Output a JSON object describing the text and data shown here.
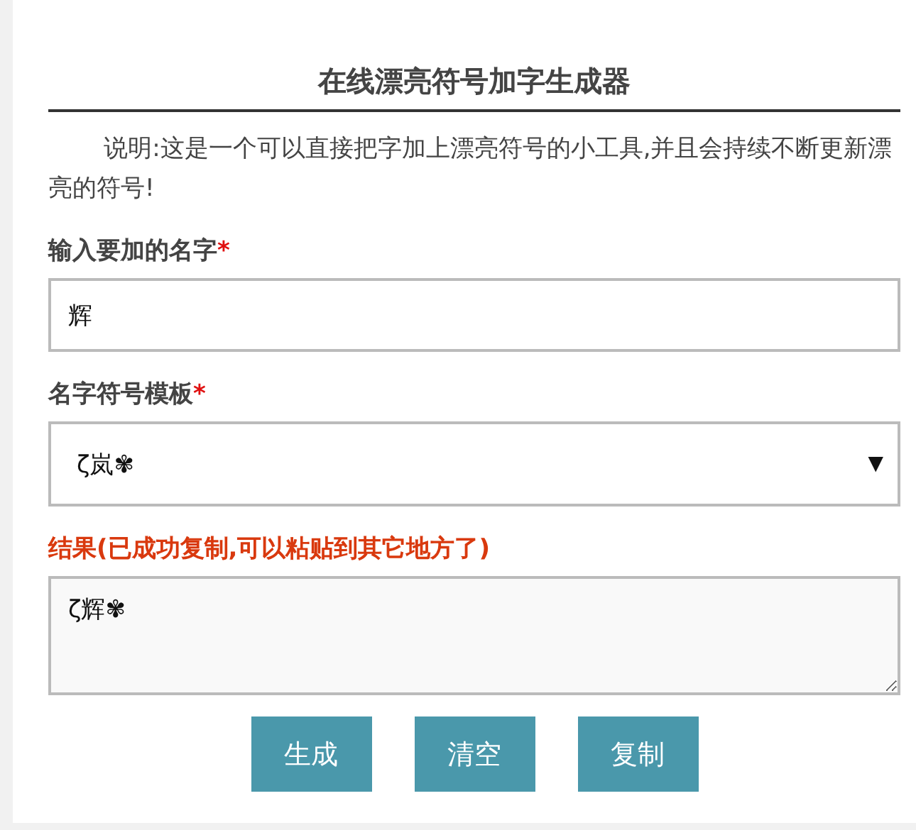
{
  "title": "在线漂亮符号加字生成器",
  "description": "说明:这是一个可以直接把字加上漂亮符号的小工具,并且会持续不断更新漂亮的符号!",
  "name_field": {
    "label": "输入要加的名字",
    "required_mark": "*",
    "value": "辉"
  },
  "template_select": {
    "label": "名字符号模板",
    "required_mark": "*",
    "value": "ζ岚✾",
    "arrow": "▼"
  },
  "result": {
    "label": "结果(已成功复制,可以粘贴到其它地方了)",
    "value": "ζ辉✾"
  },
  "buttons": [
    {
      "label": "生成"
    },
    {
      "label": "清空"
    },
    {
      "label": "复制"
    }
  ]
}
